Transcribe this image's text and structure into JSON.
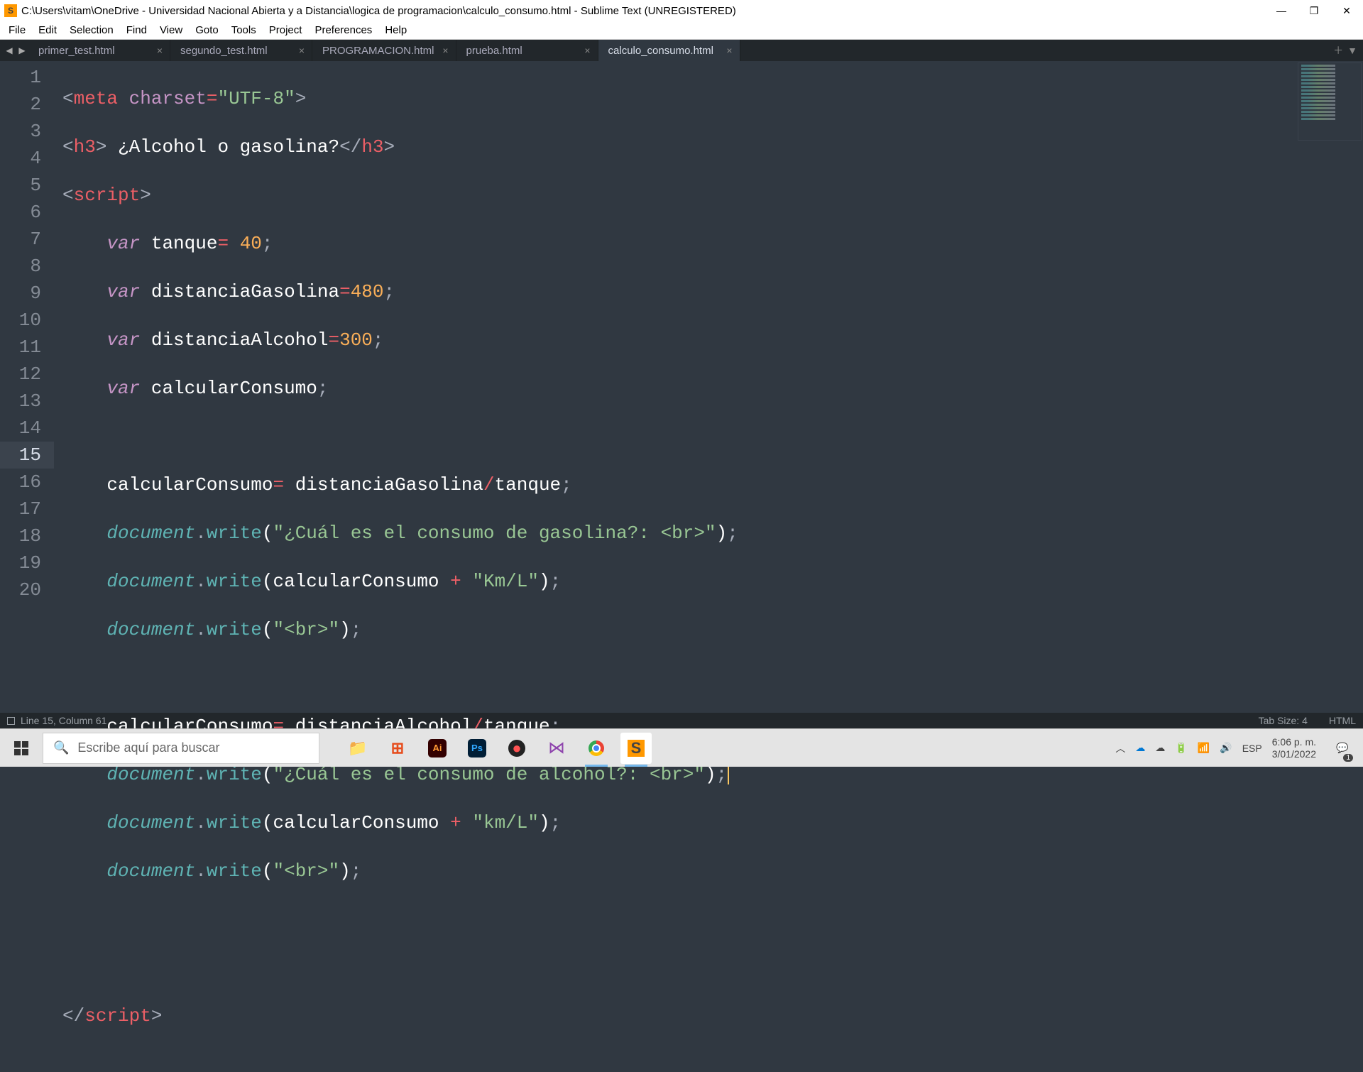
{
  "window": {
    "title": "C:\\Users\\vitam\\OneDrive - Universidad Nacional Abierta y a Distancia\\logica de programacion\\calculo_consumo.html - Sublime Text (UNREGISTERED)",
    "app_icon_letter": "S"
  },
  "menu": [
    "File",
    "Edit",
    "Selection",
    "Find",
    "View",
    "Goto",
    "Tools",
    "Project",
    "Preferences",
    "Help"
  ],
  "tabs": [
    {
      "label": "primer_test.html",
      "active": false
    },
    {
      "label": "segundo_test.html",
      "active": false
    },
    {
      "label": "PROGRAMACION.html",
      "active": false
    },
    {
      "label": "prueba.html",
      "active": false
    },
    {
      "label": "calculo_consumo.html",
      "active": true
    }
  ],
  "code": {
    "meta_charset_val": "\"UTF-8\"",
    "h3_text": " ¿Alcohol o gasolina?",
    "var_kw": "var",
    "tanque_name": "tanque",
    "tanque_val": "40",
    "distGas_name": "distanciaGasolina",
    "distGas_val": "480",
    "distAlc_name": "distanciaAlcohol",
    "distAlc_val": "300",
    "calcVar_name": "calcularConsumo",
    "doc": "document",
    "write": "write",
    "str_gas_q": "\"¿Cuál es el consumo de gasolina?: <br>\"",
    "str_kml1": "\"Km/L\"",
    "str_br": "\"<br>\"",
    "str_alc_q": "\"¿Cuál es el consumo de alcohol?: <br>\"",
    "str_kml2": "\"km/L\""
  },
  "status": {
    "cursor": "Line 15, Column 61",
    "tabsize": "Tab Size: 4",
    "lang": "HTML"
  },
  "taskbar": {
    "search_placeholder": "Escribe aquí para buscar",
    "lang": "ESP",
    "time": "6:06 p. m.",
    "date": "3/01/2022",
    "notif_count": "1"
  }
}
